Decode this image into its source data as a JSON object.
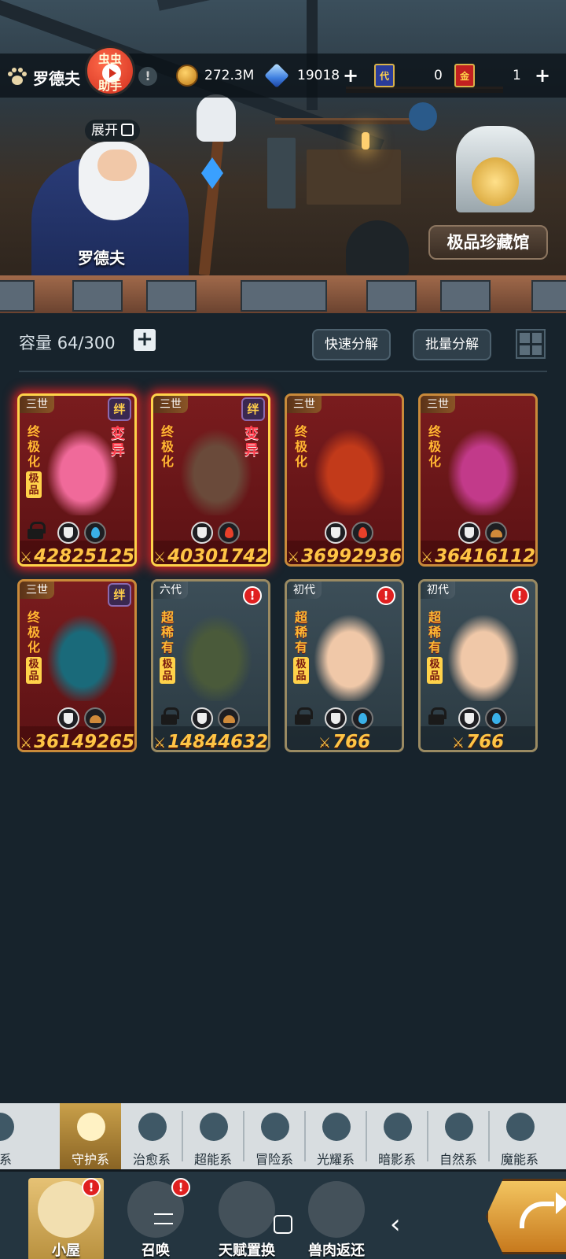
{
  "header": {
    "player_name": "罗德夫",
    "helper_label_1": "虫虫",
    "helper_label_2": "助手",
    "expand_label": "展开",
    "alert_glyph": "!"
  },
  "resources": {
    "gold": "272.3M",
    "diamonds": "19018",
    "ticket_a_glyph": "代",
    "ticket_a_count": "0",
    "ticket_b_glyph": "金",
    "ticket_b_count": "1",
    "plus_glyph": "+"
  },
  "scene": {
    "npc_name": "罗德夫",
    "museum_button": "极品珍藏馆"
  },
  "inventory": {
    "capacity_label": "容量",
    "capacity_value": "64/300",
    "add_glyph": "+",
    "quick_decompose": "快速分解",
    "batch_decompose": "批量分解"
  },
  "cards": [
    {
      "gen": "三世",
      "badge": "绊",
      "rank": "终极化",
      "grade": "极品",
      "mutation": "变异",
      "element": "water",
      "locked": true,
      "selected": true,
      "power": "42825125",
      "style": "red"
    },
    {
      "gen": "三世",
      "badge": "绊",
      "rank": "终极化",
      "grade": "",
      "mutation": "变异",
      "element": "fire",
      "locked": false,
      "selected": true,
      "power": "40301742",
      "style": "red"
    },
    {
      "gen": "三世",
      "badge": "",
      "rank": "终极化",
      "grade": "",
      "mutation": "",
      "element": "fire",
      "locked": false,
      "selected": false,
      "power": "36992936",
      "style": "red"
    },
    {
      "gen": "三世",
      "badge": "",
      "rank": "终极化",
      "grade": "",
      "mutation": "",
      "element": "earth",
      "locked": false,
      "selected": false,
      "power": "36416112",
      "style": "red"
    },
    {
      "gen": "三世",
      "badge": "绊",
      "rank": "终极化",
      "grade": "极品",
      "mutation": "",
      "element": "earth",
      "locked": false,
      "selected": false,
      "power": "36149265",
      "style": "red"
    },
    {
      "gen": "六代",
      "badge": "!",
      "rank": "超稀有",
      "grade": "极品",
      "mutation": "",
      "element": "earth",
      "locked": true,
      "selected": false,
      "power": "14844632",
      "style": "teal"
    },
    {
      "gen": "初代",
      "badge": "!",
      "rank": "超稀有",
      "grade": "极品",
      "mutation": "",
      "element": "water",
      "locked": true,
      "selected": false,
      "power": "766",
      "style": "teal"
    },
    {
      "gen": "初代",
      "badge": "!",
      "rank": "超稀有",
      "grade": "极品",
      "mutation": "",
      "element": "water",
      "locked": true,
      "selected": false,
      "power": "766",
      "style": "teal"
    }
  ],
  "category_tabs": [
    {
      "label": "斗系",
      "icon": "fist-icon",
      "active": false
    },
    {
      "label": "守护系",
      "icon": "shield-icon",
      "active": true
    },
    {
      "label": "治愈系",
      "icon": "sprout-icon",
      "active": false
    },
    {
      "label": "超能系",
      "icon": "alien-icon",
      "active": false
    },
    {
      "label": "冒险系",
      "icon": "lantern-icon",
      "active": false
    },
    {
      "label": "光耀系",
      "icon": "star-icon",
      "active": false
    },
    {
      "label": "暗影系",
      "icon": "crescent-icon",
      "active": false
    },
    {
      "label": "自然系",
      "icon": "leaf-icon",
      "active": false
    },
    {
      "label": "魔能系",
      "icon": "rune-icon",
      "active": false
    }
  ],
  "bottom_nav": [
    {
      "label": "小屋",
      "icon": "house-icon",
      "active": true,
      "alert": true
    },
    {
      "label": "召唤",
      "icon": "egg-icon",
      "active": false,
      "alert": true
    },
    {
      "label": "天赋置换",
      "icon": "swap-icon",
      "active": false,
      "alert": false
    },
    {
      "label": "兽肉返还",
      "icon": "meat-icon",
      "active": false,
      "alert": false
    }
  ],
  "colors": {
    "background": "#17232c",
    "card_red": "#7a1c1e",
    "card_teal": "#3c4e58",
    "power_gold": "#ffc445",
    "accent_gold": "#c9a04a"
  }
}
